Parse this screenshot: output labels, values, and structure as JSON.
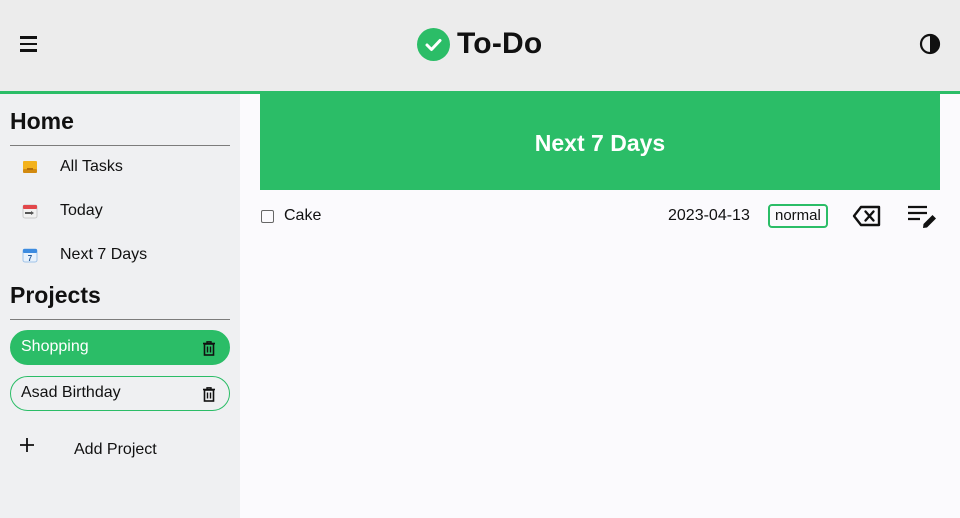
{
  "header": {
    "title": "To-Do",
    "brand_color": "#2bbd67",
    "menu_icon": "hamburger-menu-icon",
    "theme_icon": "contrast-toggle-icon"
  },
  "sidebar": {
    "home_title": "Home",
    "nav": [
      {
        "label": "All Tasks",
        "icon": "inbox-tray-icon"
      },
      {
        "label": "Today",
        "icon": "calendar-today-icon"
      },
      {
        "label": "Next 7 Days",
        "icon": "calendar-week-icon"
      }
    ],
    "projects_title": "Projects",
    "projects": [
      {
        "name": "Shopping",
        "active": true
      },
      {
        "name": "Asad Birthday",
        "active": false
      }
    ],
    "add_project_label": "Add Project"
  },
  "main": {
    "heading": "Next 7 Days",
    "tasks": [
      {
        "name": "Cake",
        "date": "2023-04-13",
        "priority": "normal",
        "done": false
      }
    ]
  }
}
